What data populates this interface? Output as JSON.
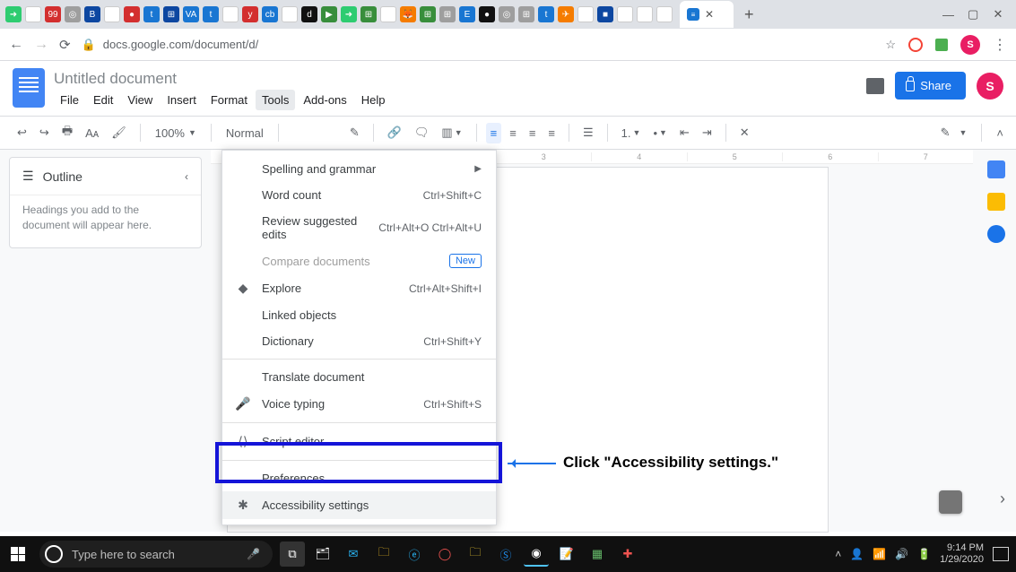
{
  "browser": {
    "active_tab_close_aria": "Close tab",
    "new_tab_aria": "New tab",
    "window": {
      "min": "—",
      "max": "▢",
      "close": "✕"
    },
    "url": "docs.google.com/document/d/",
    "nav": {
      "back": "←",
      "forward": "→",
      "reload": "⟳"
    },
    "star": "☆",
    "avatar_letter": "S",
    "menu_dots": "⋮"
  },
  "docs": {
    "title": "Untitled document",
    "menus": {
      "file": "File",
      "edit": "Edit",
      "view": "View",
      "insert": "Insert",
      "format": "Format",
      "tools": "Tools",
      "addons": "Add-ons",
      "help": "Help"
    },
    "share_label": "Share",
    "avatar_letter": "S",
    "toolbar": {
      "undo": "↩",
      "redo": "↪",
      "print": "🖶",
      "spell": "Aᴀ",
      "paint": "🖌",
      "zoom": "100%",
      "style": "Normal",
      "link": "🔗",
      "comment": "🗨",
      "image": "▥",
      "align_left": "≡",
      "align_center": "≡",
      "align_right": "≡",
      "align_just": "≡",
      "line_spacing": "☰",
      "num_list": "1.",
      "bul_list": "•",
      "ind_dec": "⇤",
      "ind_inc": "⇥",
      "clear": "✕",
      "pen": "✎",
      "collapse": "˄"
    },
    "outline": {
      "heading": "Outline",
      "chev": "‹",
      "empty": "Headings you add to the document will appear here."
    },
    "ruler": {
      "m3": "3",
      "m4": "4",
      "m5": "5",
      "m6": "6",
      "m7": "7"
    },
    "tools_menu": {
      "spelling": "Spelling and grammar",
      "wordcount": "Word count",
      "wordcount_sc": "Ctrl+Shift+C",
      "review": "Review suggested edits",
      "review_sc": "Ctrl+Alt+O Ctrl+Alt+U",
      "compare": "Compare documents",
      "new_pill": "New",
      "explore": "Explore",
      "explore_sc": "Ctrl+Alt+Shift+I",
      "linked": "Linked objects",
      "dictionary": "Dictionary",
      "dictionary_sc": "Ctrl+Shift+Y",
      "translate": "Translate document",
      "voice": "Voice typing",
      "voice_sc": "Ctrl+Shift+S",
      "script": "Script editor",
      "prefs": "Preferences",
      "a11y": "Accessibility settings"
    }
  },
  "annotation": {
    "text": "Click \"Accessibility settings.\""
  },
  "taskbar": {
    "search_placeholder": "Type here to search",
    "time": "9:14 PM",
    "date": "1/29/2020"
  }
}
